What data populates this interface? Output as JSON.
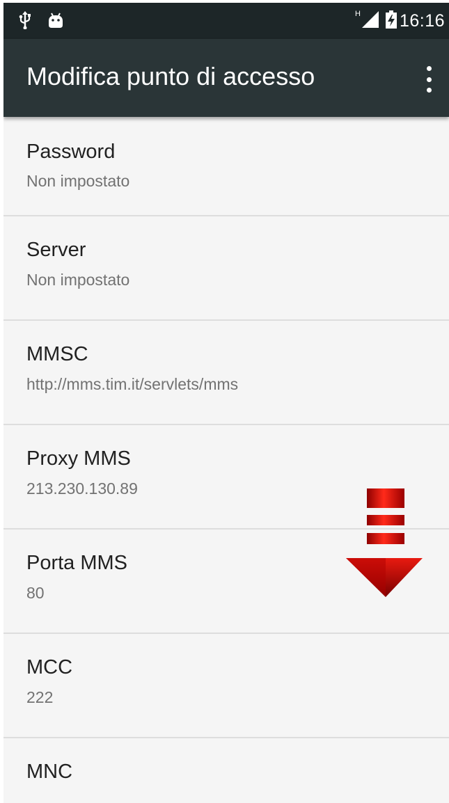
{
  "status_bar": {
    "left_icons": [
      "usb-icon",
      "android-icon"
    ],
    "network_type": "H",
    "signal_icon": "signal-icon",
    "battery_icon": "battery-charging-icon",
    "time": "16:16"
  },
  "app_bar": {
    "title": "Modifica punto di accesso",
    "overflow_icon": "more-vert-icon"
  },
  "settings": [
    {
      "title": "Password",
      "value": "Non impostato"
    },
    {
      "title": "Server",
      "value": "Non impostato"
    },
    {
      "title": "MMSC",
      "value": "http://mms.tim.it/servlets/mms"
    },
    {
      "title": "Proxy MMS",
      "value": "213.230.130.89"
    },
    {
      "title": "Porta MMS",
      "value": "80"
    },
    {
      "title": "MCC",
      "value": "222"
    },
    {
      "title": "MNC",
      "value": ""
    }
  ],
  "overlay": {
    "icon": "scroll-down-arrow-icon",
    "color": "#cc0000"
  },
  "colors": {
    "status_bar": "#1d2628",
    "app_bar": "#2a3537",
    "background": "#f5f5f5",
    "divider": "#dddddd",
    "primary_text": "#212121",
    "secondary_text": "#727272"
  }
}
